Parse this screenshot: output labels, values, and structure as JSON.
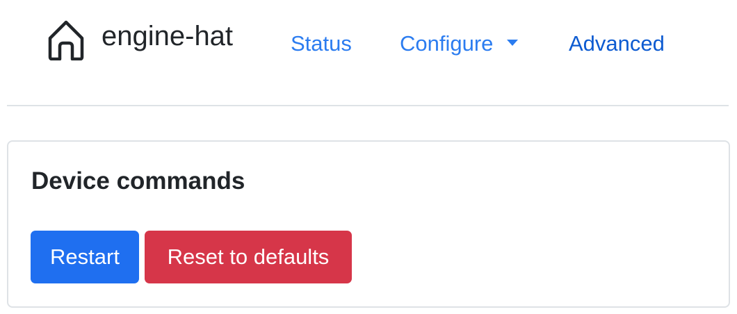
{
  "navbar": {
    "brand_icon": "house-icon",
    "brand_text": "engine-hat",
    "links": [
      {
        "label": "Status"
      },
      {
        "label": "Configure",
        "has_dropdown": true,
        "icon": "caret-down-icon"
      },
      {
        "label": "Advanced"
      }
    ]
  },
  "card": {
    "title": "Device commands",
    "buttons": [
      {
        "label": "Restart",
        "color": "#1f6ff0"
      },
      {
        "label": "Reset to defaults",
        "color": "#d63649"
      }
    ]
  },
  "colors": {
    "link": "#2b7cf0",
    "primary": "#1f6ff0",
    "danger": "#d63649",
    "border": "#dee2e6"
  }
}
